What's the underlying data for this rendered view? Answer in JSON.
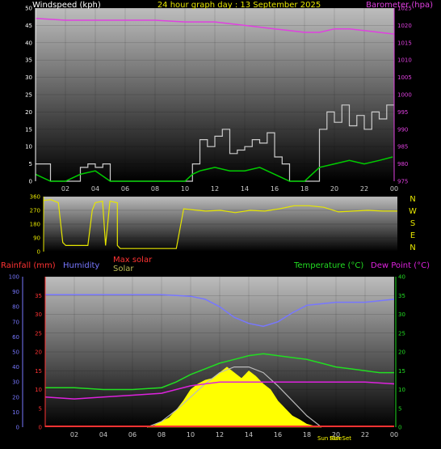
{
  "header": {
    "left_label": "Windspeed (kph)",
    "title": "24 hour graph day : 13 September 2025",
    "right_label": "Barometer (hpa)"
  },
  "bottom_header": {
    "rainfall": "Rainfall (mm)",
    "humidity": "Humidity",
    "max_solar": "Max solar",
    "solar": "Solar",
    "temperature": "Temperature (°C)",
    "dew_point": "Dew Point (°C)",
    "sunrise_marker": "Sun Rise",
    "sunset_marker": "Sun Set"
  },
  "compass": [
    "N",
    "W",
    "S",
    "E",
    "N"
  ],
  "colors": {
    "wind": "#e6e6e6",
    "gust": "#cccccc",
    "wind_avg": "#00cc00",
    "barometer": "#e040e0",
    "direction": "#e6e600",
    "rain": "#ff3333",
    "humidity": "#7777ff",
    "max_solar": "#bbbbbb",
    "solar": "#ffff00",
    "temperature": "#22dd22",
    "dew_point": "#dd22dd"
  },
  "chart_data": [
    {
      "type": "line",
      "name_key": "wind_baro",
      "x_ticks": [
        "02",
        "04",
        "06",
        "08",
        "10",
        "12",
        "14",
        "16",
        "18",
        "20",
        "22",
        "00"
      ],
      "y_left_ticks": [
        "0",
        "5",
        "10",
        "15",
        "20",
        "25",
        "30",
        "35",
        "40",
        "45",
        "50"
      ],
      "y_left_range": [
        0,
        50
      ],
      "y_right_ticks": [
        "975",
        "980",
        "985",
        "990",
        "995",
        "1000",
        "1005",
        "1010",
        "1015",
        "1020",
        "1025"
      ],
      "y_right_range": [
        975,
        1025
      ],
      "series": [
        {
          "name": "gust",
          "x": [
            0,
            0.5,
            1,
            1.5,
            2,
            2.5,
            3,
            3.5,
            4,
            4.5,
            5,
            5.5,
            6,
            6.5,
            7,
            7.5,
            8,
            8.5,
            9,
            9.5,
            10,
            10.5,
            11,
            11.5,
            12,
            12.5,
            13,
            13.5,
            14,
            14.5,
            15,
            15.5,
            16,
            16.5,
            17,
            17.5,
            18,
            18.5,
            19,
            19.5,
            20,
            20.5,
            21,
            21.5,
            22,
            22.5,
            23,
            23.5
          ],
          "y": [
            5,
            5,
            0,
            0,
            0,
            0,
            4,
            5,
            4,
            5,
            0,
            0,
            0,
            0,
            0,
            0,
            0,
            0,
            0,
            0,
            0,
            5,
            12,
            10,
            13,
            15,
            8,
            9,
            10,
            12,
            11,
            14,
            7,
            5,
            0,
            0,
            0,
            0,
            15,
            20,
            17,
            22,
            16,
            19,
            15,
            20,
            18,
            22
          ]
        },
        {
          "name": "average",
          "x": [
            0,
            1,
            2,
            3,
            4,
            5,
            6,
            7,
            8,
            9,
            10,
            10.5,
            11,
            12,
            13,
            14,
            15,
            16,
            17,
            18,
            19,
            20,
            21,
            22,
            23,
            23.9
          ],
          "y": [
            2,
            0,
            0,
            2,
            3,
            0,
            0,
            0,
            0,
            0,
            0,
            2,
            3,
            4,
            3,
            3,
            4,
            2,
            0,
            0,
            4,
            5,
            6,
            5,
            6,
            7
          ]
        },
        {
          "name": "barometer",
          "x": [
            0,
            2,
            4,
            6,
            8,
            10,
            12,
            13,
            14,
            15,
            16,
            17,
            18,
            19,
            20,
            21,
            22,
            23,
            24
          ],
          "y": [
            1022,
            1021.5,
            1021.5,
            1021.5,
            1021.5,
            1021,
            1021,
            1020.5,
            1020,
            1019.5,
            1019,
            1018.5,
            1018,
            1018,
            1019,
            1019,
            1018.5,
            1018,
            1017.5
          ]
        }
      ]
    },
    {
      "type": "line",
      "name_key": "wind_direction",
      "y_ticks": [
        "360",
        "270",
        "180",
        "90",
        "0"
      ],
      "y_range": [
        0,
        360
      ],
      "series": [
        {
          "name": "direction",
          "x": [
            0,
            0.5,
            1,
            1.3,
            1.5,
            2,
            2.5,
            3,
            3.3,
            3.5,
            4,
            4.2,
            4.5,
            5,
            5,
            5.2,
            6,
            7,
            7.5,
            8,
            9,
            9.5,
            10,
            11,
            12,
            13,
            14,
            15,
            16,
            17,
            18,
            19,
            20,
            21,
            22,
            23,
            24
          ],
          "y": [
            335,
            340,
            320,
            60,
            40,
            40,
            40,
            40,
            270,
            320,
            330,
            40,
            330,
            320,
            40,
            20,
            20,
            20,
            20,
            20,
            20,
            280,
            275,
            265,
            270,
            255,
            270,
            265,
            280,
            300,
            300,
            290,
            260,
            265,
            270,
            265,
            265
          ]
        }
      ]
    },
    {
      "type": "line",
      "name_key": "temp_hum_solar",
      "x_ticks": [
        "02",
        "04",
        "06",
        "08",
        "10",
        "12",
        "14",
        "16",
        "18",
        "20",
        "22",
        "00"
      ],
      "humidity_ticks": [
        "0",
        "10",
        "20",
        "30",
        "40",
        "50",
        "60",
        "70",
        "80",
        "90",
        "100"
      ],
      "rain_ticks": [
        "0",
        "5",
        "10",
        "15",
        "20",
        "25",
        "30",
        "35"
      ],
      "temp_ticks": [
        "0",
        "5",
        "10",
        "15",
        "20",
        "25",
        "30",
        "35",
        "40"
      ],
      "temp_range": [
        0,
        40
      ],
      "humidity_range": [
        0,
        100
      ],
      "series": [
        {
          "name": "humidity",
          "x": [
            0,
            2,
            4,
            6,
            8,
            10,
            11,
            12,
            13,
            14,
            15,
            16,
            17,
            18,
            19,
            20,
            21,
            22,
            23,
            24
          ],
          "y": [
            88,
            88,
            88,
            88,
            88,
            87,
            85,
            80,
            73,
            69,
            67,
            70,
            76,
            81,
            82,
            83,
            83,
            83,
            84,
            85
          ]
        },
        {
          "name": "temperature",
          "x": [
            0,
            2,
            4,
            6,
            8,
            9,
            10,
            11,
            12,
            13,
            14,
            15,
            16,
            17,
            18,
            19,
            20,
            21,
            22,
            23,
            24
          ],
          "y": [
            10.5,
            10.5,
            10,
            10,
            10.5,
            12,
            14,
            15.5,
            17,
            18,
            19,
            19.5,
            19,
            18.5,
            18,
            17,
            16,
            15.5,
            15,
            14.5,
            14.5
          ]
        },
        {
          "name": "dew_point",
          "x": [
            0,
            2,
            4,
            6,
            8,
            10,
            12,
            14,
            16,
            18,
            20,
            22,
            24
          ],
          "y": [
            8,
            7.5,
            8,
            8.5,
            9,
            11,
            12,
            12,
            12,
            12,
            12,
            12,
            11.5
          ]
        },
        {
          "name": "max_solar",
          "x": [
            7,
            8,
            9,
            10,
            11,
            12,
            13,
            14,
            15,
            16,
            17,
            18,
            19
          ],
          "y": [
            0,
            1.5,
            4.5,
            8,
            11.5,
            14.5,
            16,
            16,
            14.5,
            11,
            7,
            3,
            0
          ]
        },
        {
          "name": "solar",
          "x": [
            7,
            7.5,
            8,
            8.5,
            9,
            9.5,
            10,
            10.5,
            11,
            11.5,
            12,
            12.5,
            13,
            13.5,
            14,
            14.5,
            15,
            15.5,
            16,
            16.5,
            17,
            17.5,
            18,
            18.5,
            19
          ],
          "y": [
            0,
            0.5,
            1.5,
            2.5,
            4.5,
            7,
            10,
            11.5,
            12.5,
            13,
            14.5,
            16,
            14.5,
            13,
            15,
            13.5,
            11.5,
            10,
            7,
            5,
            3,
            2,
            0.8,
            0.3,
            0
          ]
        },
        {
          "name": "rain",
          "x": [
            0,
            24
          ],
          "y": [
            0,
            0
          ]
        }
      ]
    }
  ]
}
